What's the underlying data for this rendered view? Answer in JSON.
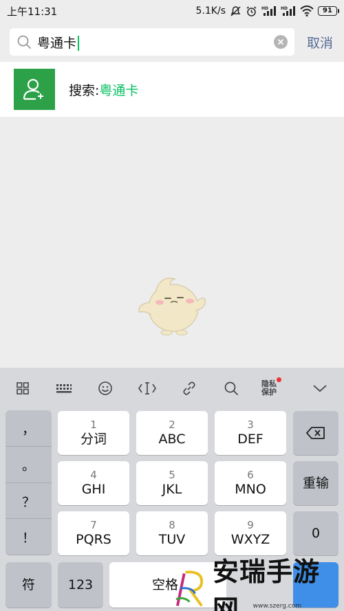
{
  "status_bar": {
    "time": "上午11:31",
    "network_speed": "5.1K/s",
    "battery": "91",
    "icons": [
      "mute-icon",
      "alarm-icon",
      "hd-signal-icon",
      "hd-signal-icon",
      "wifi-icon",
      "battery-icon"
    ]
  },
  "search": {
    "value": "粤通卡",
    "cancel_label": "取消"
  },
  "result": {
    "prefix": "搜索:",
    "keyword": "粤通卡"
  },
  "keyboard": {
    "toolbar": [
      "grid-icon",
      "keyboard-icon",
      "emoji-icon",
      "cursor-icon",
      "link-icon",
      "search-icon",
      "privacy",
      "collapse-icon"
    ],
    "privacy_label_1": "隐私",
    "privacy_label_2": "保护",
    "punctuation": [
      "，",
      "。",
      "？",
      "！"
    ],
    "keys": [
      {
        "num": "1",
        "label": "分词"
      },
      {
        "num": "2",
        "label": "ABC"
      },
      {
        "num": "3",
        "label": "DEF"
      },
      {
        "num": "4",
        "label": "GHI"
      },
      {
        "num": "5",
        "label": "JKL"
      },
      {
        "num": "6",
        "label": "MNO"
      },
      {
        "num": "7",
        "label": "PQRS"
      },
      {
        "num": "8",
        "label": "TUV"
      },
      {
        "num": "9",
        "label": "WXYZ"
      }
    ],
    "retype_label": "重输",
    "zero_label": "0",
    "symbol_label": "符",
    "num123_label": "123",
    "space_label": "空格"
  },
  "watermark": {
    "brand": "安瑞手游网",
    "url": "www.szerg.com"
  },
  "colors": {
    "accent_green": "#07c160",
    "link_blue": "#576b95",
    "icon_green": "#2ca148"
  }
}
